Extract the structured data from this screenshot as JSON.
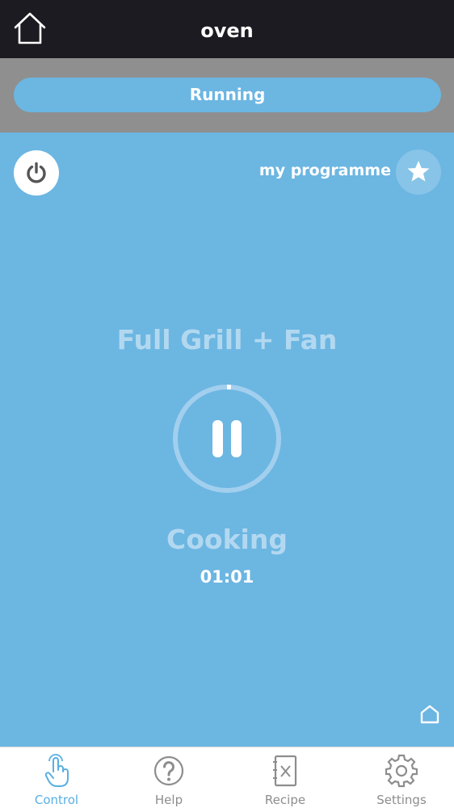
{
  "header": {
    "title": "oven"
  },
  "status": {
    "label": "Running"
  },
  "controls": {
    "favourite_label": "my programme"
  },
  "cooking": {
    "programme": "Full Grill + Fan",
    "phase": "Cooking",
    "time": "01:01",
    "progress": 0.01
  },
  "tabs": [
    {
      "label": "Control",
      "icon": "touch-hand-icon",
      "active": true
    },
    {
      "label": "Help",
      "icon": "question-icon",
      "active": false
    },
    {
      "label": "Recipe",
      "icon": "recipe-book-icon",
      "active": false
    },
    {
      "label": "Settings",
      "icon": "gear-icon",
      "active": false
    }
  ],
  "colors": {
    "accent": "#6cb6e2",
    "topbar": "#1b1b21",
    "band": "#8f8f8f"
  }
}
